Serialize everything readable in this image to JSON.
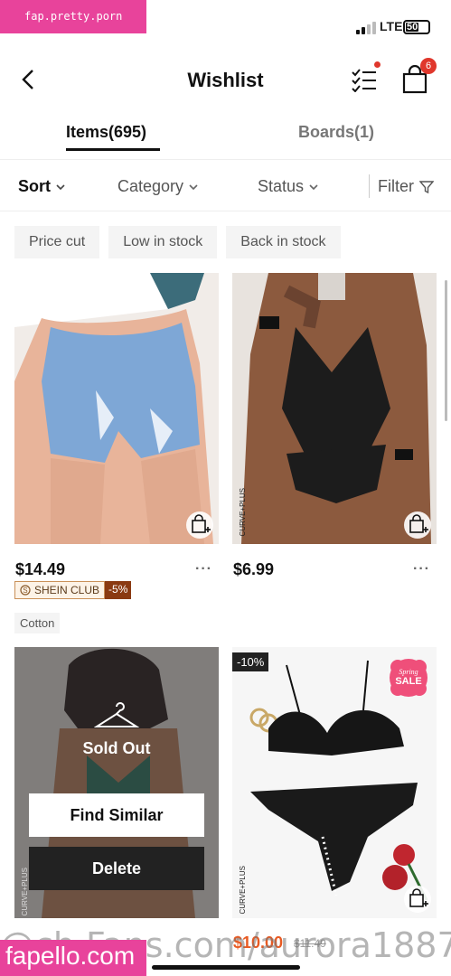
{
  "watermark_top": "fap.pretty.porn",
  "status": {
    "network": "LTE",
    "battery": "50"
  },
  "header": {
    "title": "Wishlist",
    "cart_count": "6"
  },
  "tabs": [
    {
      "label": "Items(695)"
    },
    {
      "label": "Boards(1)"
    }
  ],
  "filters": [
    {
      "label": "Sort"
    },
    {
      "label": "Category"
    },
    {
      "label": "Status"
    },
    {
      "label": "Filter"
    }
  ],
  "chips": [
    {
      "label": "Price cut"
    },
    {
      "label": "Low in stock"
    },
    {
      "label": "Back in stock"
    }
  ],
  "products": [
    {
      "price": "$14.49",
      "club_label": "SHEIN CLUB",
      "club_discount": "-5%",
      "tag": "Cotton"
    },
    {
      "price": "$6.99",
      "brand_label": "CURVE+PLUS"
    },
    {
      "status": "Sold Out",
      "find_similar": "Find Similar",
      "delete": "Delete",
      "brand_label": "CURVE+PLUS"
    },
    {
      "discount": "-10%",
      "badge_top": "Spring",
      "badge_bottom": "SALE",
      "brand_label": "CURVE+PLUS",
      "price": "$10.00",
      "original_price": "$11.49"
    }
  ],
  "more_label": "···",
  "watermark_url": "@ch.Fans.com/aurora1887",
  "watermark_bottom": "fapello.com",
  "colors": {
    "accent_red": "#e0372c",
    "watermark_pink": "#e8439b",
    "club_brown": "#8a3a12",
    "sale_orange": "#e85a22"
  }
}
